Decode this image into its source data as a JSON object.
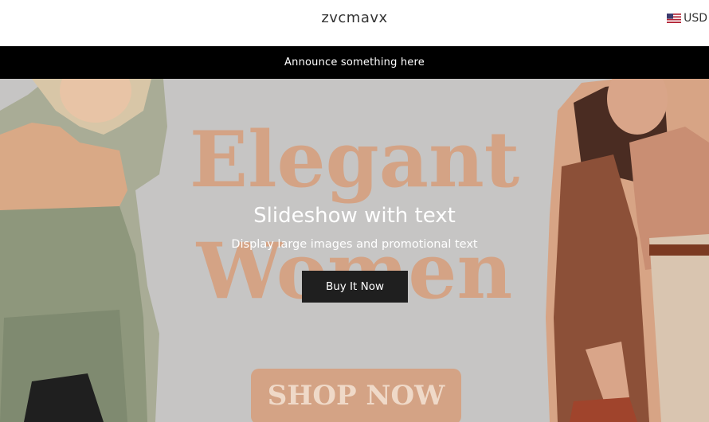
{
  "header": {
    "logo": "zvcmavx",
    "currency": {
      "flag_icon": "us-flag-icon",
      "label": "USD"
    }
  },
  "announcement": {
    "text": "Announce something here"
  },
  "slideshow": {
    "image_text": {
      "word1": "Elegant",
      "word2": "Women",
      "cta": "SHOP NOW"
    },
    "title": "Slideshow with text",
    "subtitle": "Display large images and promotional text",
    "button_label": "Buy It Now"
  },
  "colors": {
    "announcement_bg": "#000000",
    "hero_bg": "#c6c5c4",
    "headline_color": "#d4a385",
    "button_bg": "#1f1f1f"
  }
}
